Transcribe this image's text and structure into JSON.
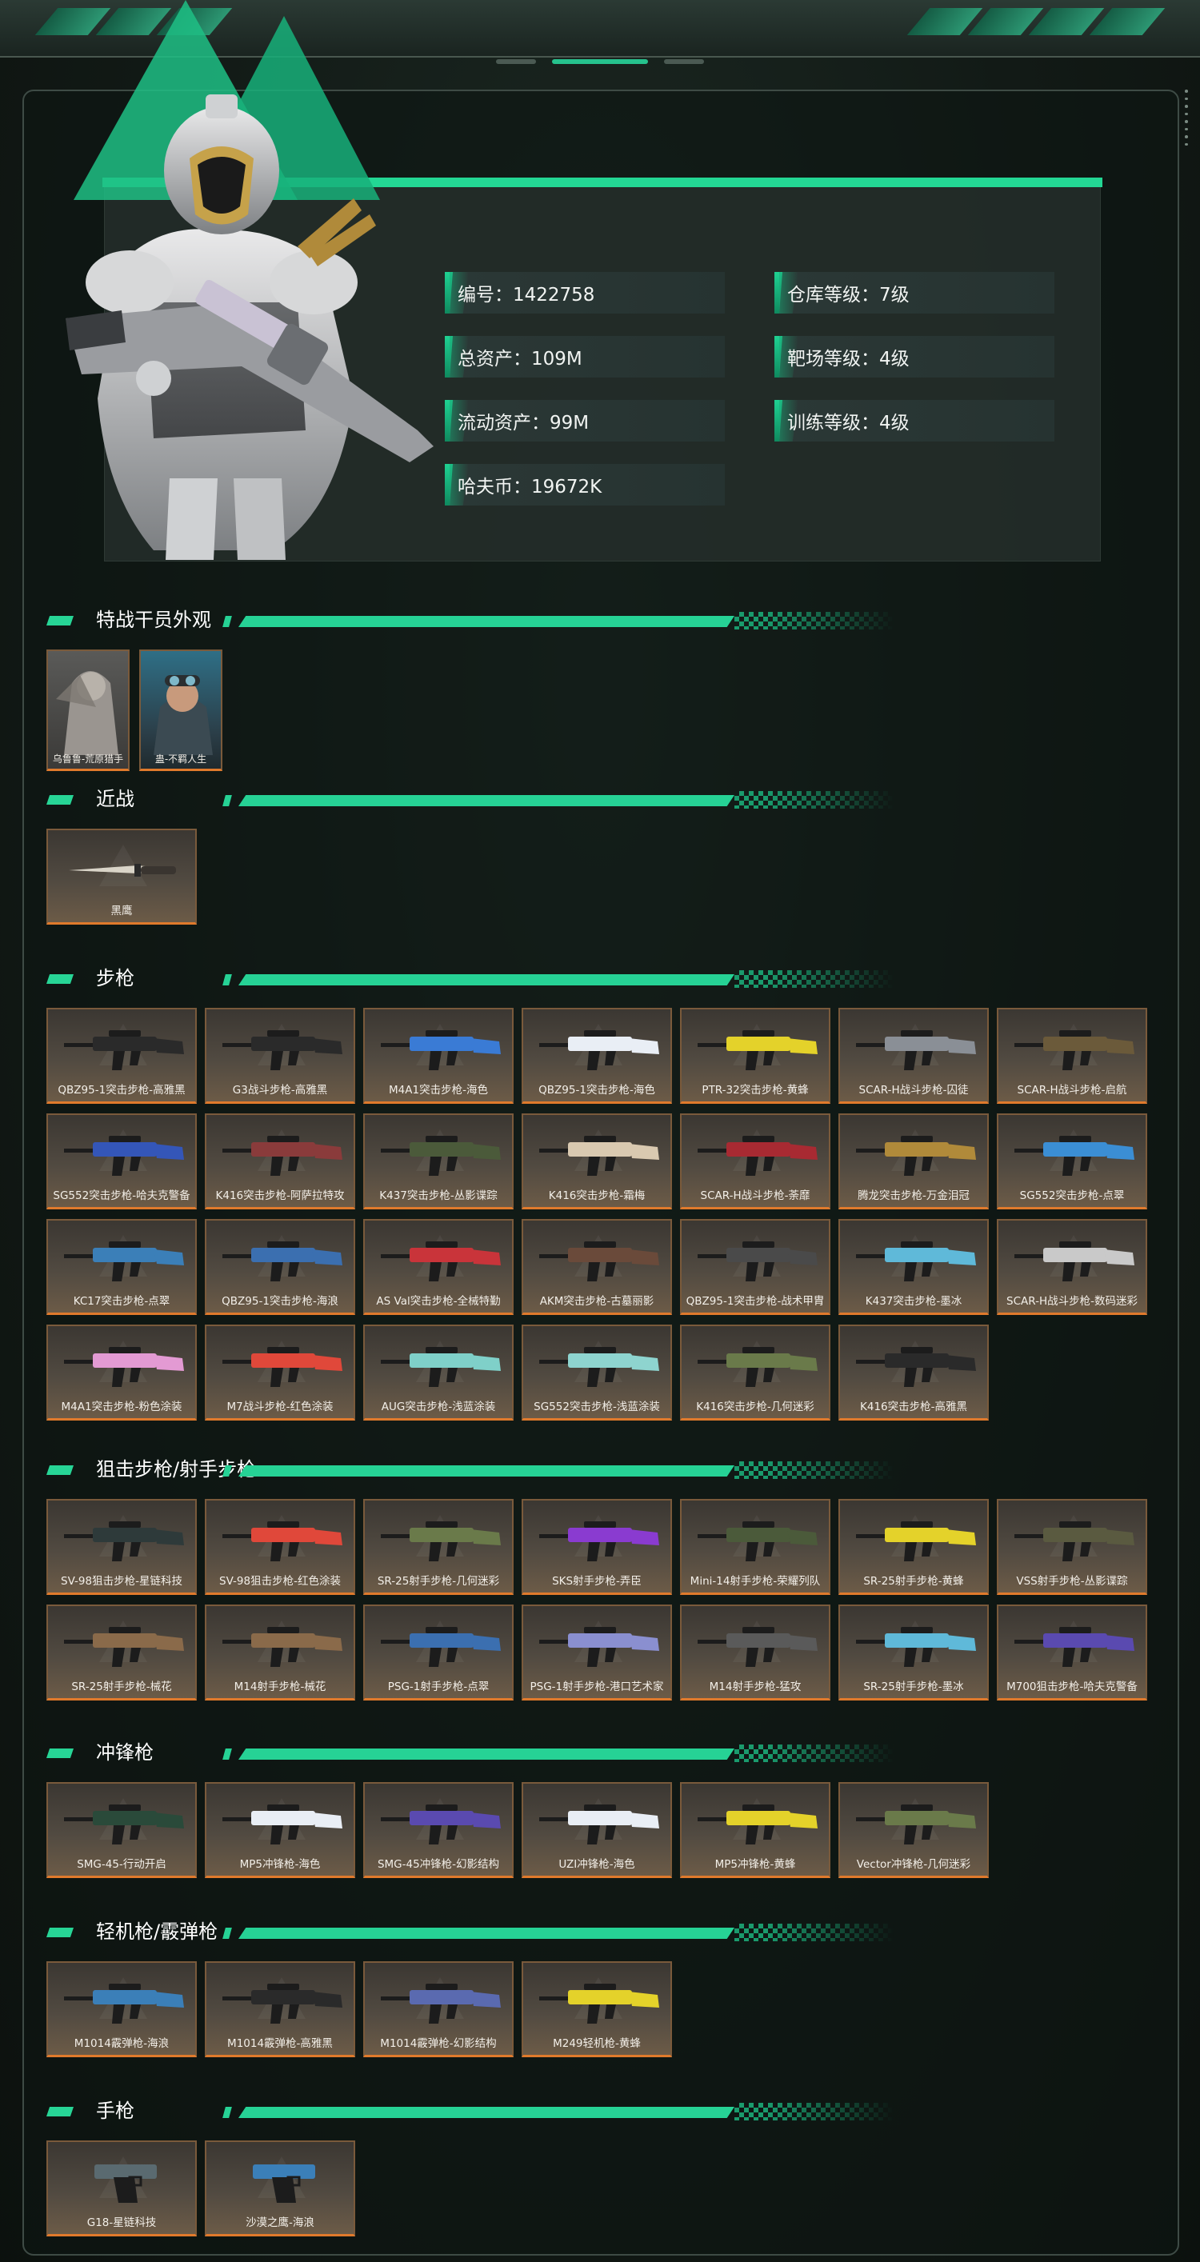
{
  "profile": {
    "stats": [
      {
        "label": "编号：1422758",
        "col": 0,
        "row": 0
      },
      {
        "label": "仓库等级：7级",
        "col": 1,
        "row": 0
      },
      {
        "label": "总资产：109M",
        "col": 0,
        "row": 1
      },
      {
        "label": "靶场等级：4级",
        "col": 1,
        "row": 1
      },
      {
        "label": "流动资产：99M",
        "col": 0,
        "row": 2
      },
      {
        "label": "训练等级：4级",
        "col": 1,
        "row": 2
      },
      {
        "label": "哈夫币：19672K",
        "col": 0,
        "row": 3
      }
    ]
  },
  "sections": [
    {
      "key": "operators",
      "title": "特战干员外观",
      "kind": "operator",
      "items": [
        "乌鲁鲁-荒原猎手",
        "蛊-不羁人生"
      ]
    },
    {
      "key": "melee",
      "title": "近战",
      "kind": "melee",
      "items": [
        "黑鹰"
      ]
    },
    {
      "key": "rifles",
      "title": "步枪",
      "kind": "gun",
      "items": [
        "QBZ95-1突击步枪-高雅黑",
        "G3战斗步枪-高雅黑",
        "M4A1突击步枪-海色",
        "QBZ95-1突击步枪-海色",
        "PTR-32突击步枪-黄蜂",
        "SCAR-H战斗步枪-囚徒",
        "SCAR-H战斗步枪-启航",
        "SG552突击步枪-哈夫克警备",
        "K416突击步枪-阿萨拉特攻",
        "K437突击步枪-丛影谍踪",
        "K416突击步枪-霜梅",
        "SCAR-H战斗步枪-荼靡",
        "腾龙突击步枪-万金泪冠",
        "SG552突击步枪-点翠",
        "KC17突击步枪-点翠",
        "QBZ95-1突击步枪-海浪",
        "AS Val突击步枪-全械特勤",
        "AKM突击步枪-古墓丽影",
        "QBZ95-1突击步枪-战术甲胄",
        "K437突击步枪-墨冰",
        "SCAR-H战斗步枪-数码迷彩",
        "M4A1突击步枪-粉色涂装",
        "M7战斗步枪-红色涂装",
        "AUG突击步枪-浅蓝涂装",
        "SG552突击步枪-浅蓝涂装",
        "K416突击步枪-几何迷彩",
        "K416突击步枪-高雅黑"
      ]
    },
    {
      "key": "snipers",
      "title": "狙击步枪/射手步枪",
      "kind": "gun",
      "items": [
        "SV-98狙击步枪-星链科技",
        "SV-98狙击步枪-红色涂装",
        "SR-25射手步枪-几何迷彩",
        "SKS射手步枪-弄臣",
        "Mini-14射手步枪-荣耀列队",
        "SR-25射手步枪-黄蜂",
        "VSS射手步枪-丛影谍踪",
        "SR-25射手步枪-械花",
        "M14射手步枪-械花",
        "PSG-1射手步枪-点翠",
        "PSG-1射手步枪-港口艺术家",
        "M14射手步枪-猛攻",
        "SR-25射手步枪-墨冰",
        "M700狙击步枪-哈夫克警备"
      ]
    },
    {
      "key": "smgs",
      "title": "冲锋枪",
      "kind": "gun",
      "items": [
        "SMG-45-行动开启",
        "MP5冲锋枪-海色",
        "SMG-45冲锋枪-幻影结构",
        "UZI冲锋枪-海色",
        "MP5冲锋枪-黄蜂",
        "Vector冲锋枪-几何迷彩"
      ]
    },
    {
      "key": "lmgs",
      "title": "轻机枪/霰弹枪",
      "kind": "gun",
      "items": [
        "M1014霰弹枪-海浪",
        "M1014霰弹枪-高雅黑",
        "M1014霰弹枪-幻影结构",
        "M249轻机枪-黄蜂"
      ]
    },
    {
      "key": "pistols",
      "title": "手枪",
      "kind": "pistol",
      "items": [
        "G18-星链科技",
        "沙漠之鹰-海浪"
      ]
    }
  ],
  "colors": {
    "accent": "#26d295",
    "card_border_bottom": "#e07a2c",
    "skin_palette": [
      "#2a2a2a",
      "#2a2a2a",
      "#3a7bd5",
      "#e9eef5",
      "#e4d22a",
      "#8a8f96",
      "#6b5a3a",
      "#3456b8",
      "#8a3b3b",
      "#4b5a3a",
      "#d9c9b0",
      "#a82a32",
      "#b08a3a",
      "#3b8ed4",
      "#3b7fb8",
      "#3b6fb0",
      "#c9343a",
      "#6a4a3a",
      "#4a4a4a",
      "#5fb9d9",
      "#c9c9c9",
      "#e39ad3",
      "#e0483a",
      "#7fd0c9",
      "#8ed4cf",
      "#6a7a4a",
      "#2a2a2a"
    ]
  }
}
